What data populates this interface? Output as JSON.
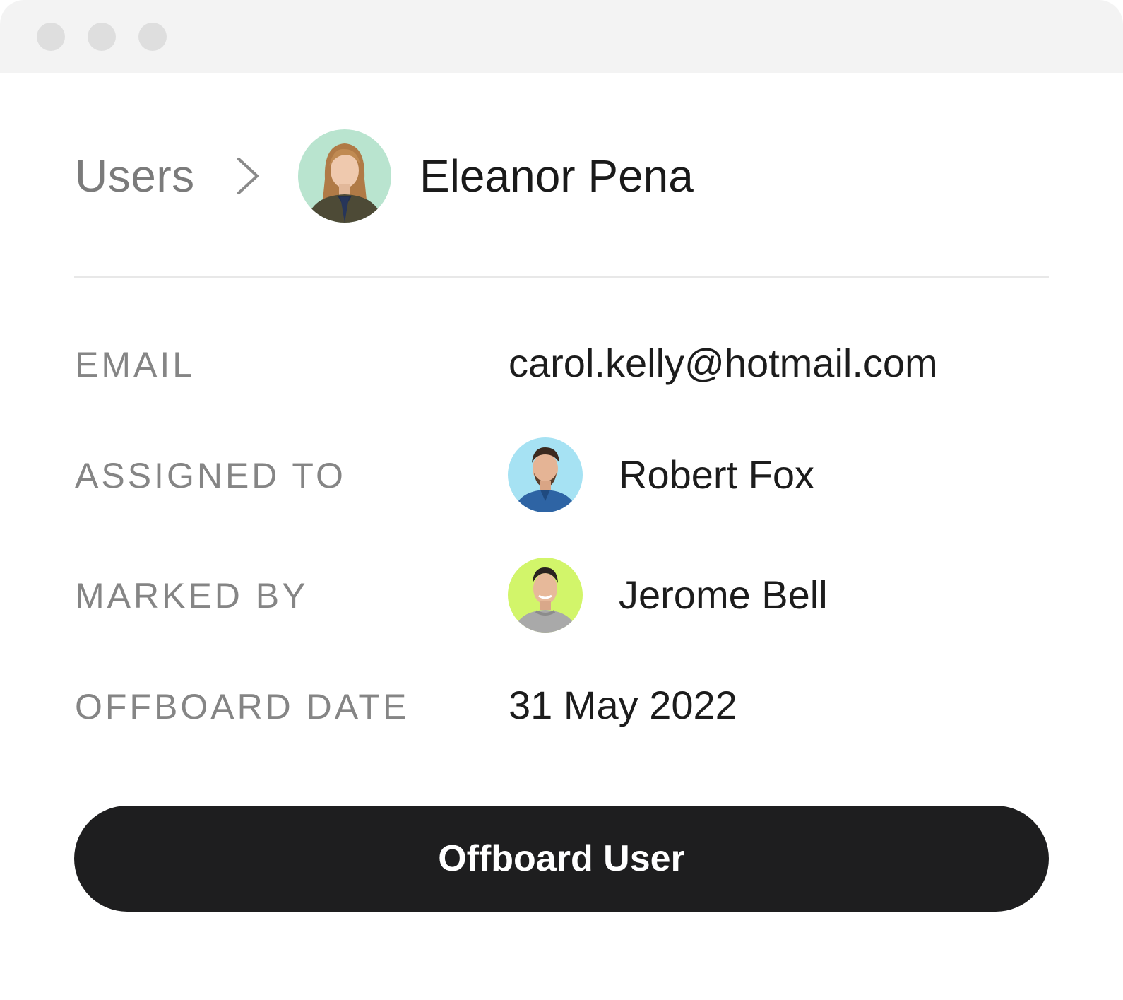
{
  "window": {
    "controls": [
      "window-dot-icon",
      "window-dot-icon",
      "window-dot-icon"
    ]
  },
  "breadcrumb": {
    "parent": "Users",
    "separator_icon": "chevron-right-icon",
    "current": "Eleanor Pena",
    "current_avatar_icon": "user-avatar"
  },
  "details": {
    "email": {
      "label": "EMAIL",
      "value": "carol.kelly@hotmail.com"
    },
    "assigned_to": {
      "label": "ASSIGNED TO",
      "value": "Robert Fox"
    },
    "marked_by": {
      "label": "MARKED BY",
      "value": "Jerome Bell"
    },
    "offboard_date": {
      "label": "OFFBOARD DATE",
      "value": "31 May 2022"
    }
  },
  "actions": {
    "offboard_label": "Offboard User"
  },
  "colors": {
    "avatar_eleanor_bg": "#b9e4cf",
    "avatar_robert_bg": "#a6e2f3",
    "avatar_jerome_bg": "#d2f56a",
    "button_bg": "#1e1e1f",
    "label_color": "#858585"
  }
}
